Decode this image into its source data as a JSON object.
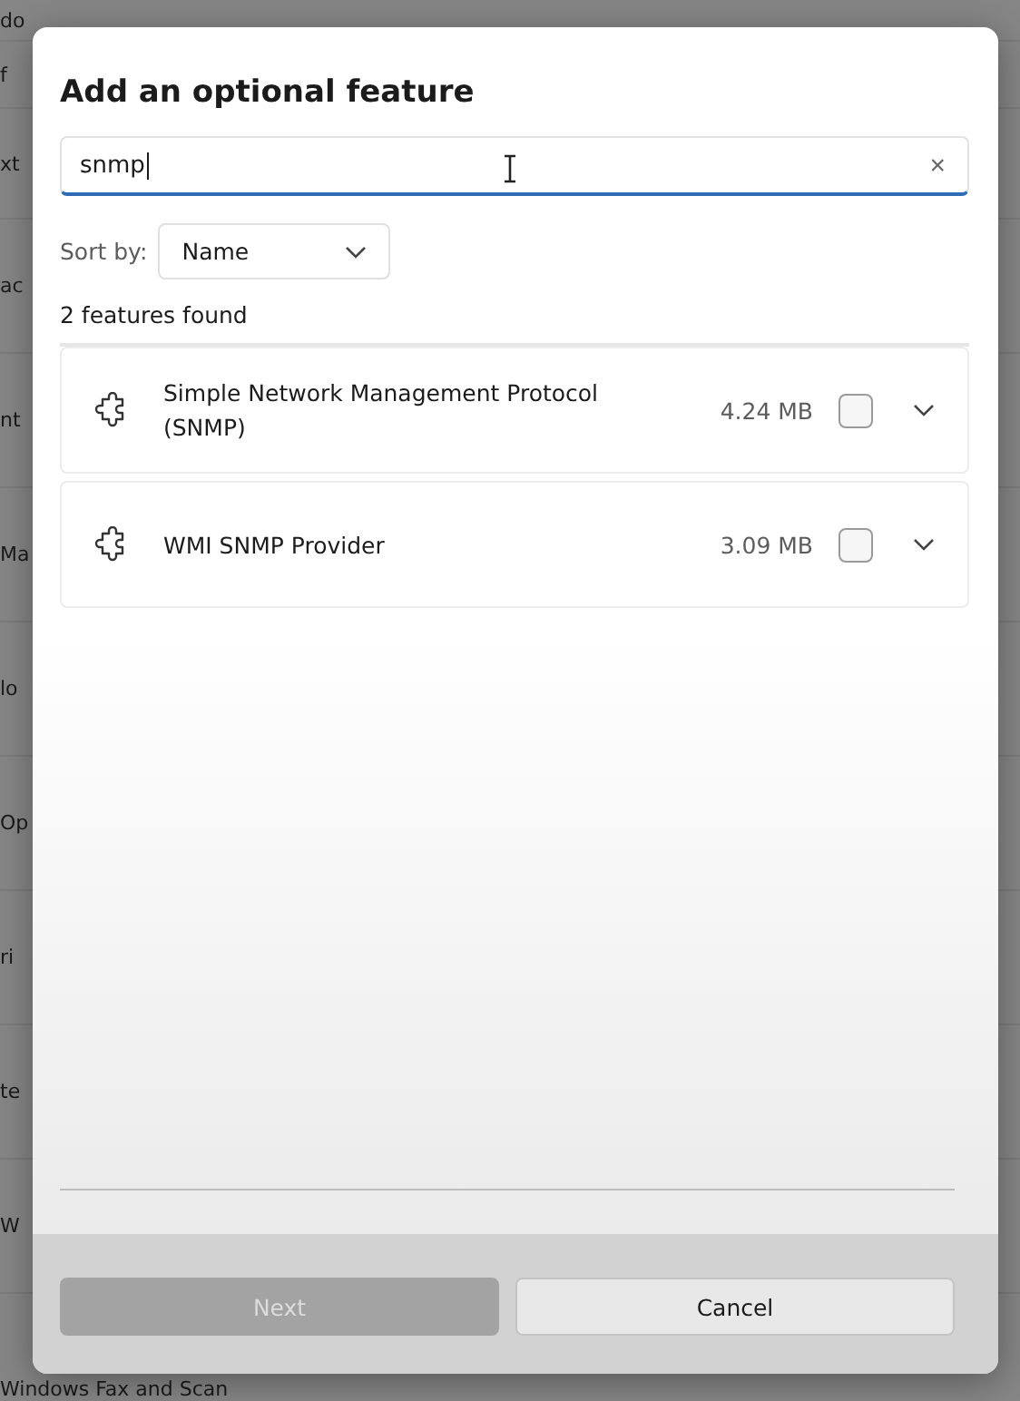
{
  "background_items": [
    "do",
    "f",
    "xt",
    "ac",
    "nt",
    "Ma",
    "lo",
    "Op",
    "ri",
    "te",
    "W",
    "Windows Fax and Scan"
  ],
  "dialog": {
    "title": "Add an optional feature",
    "search": {
      "value": "snmp",
      "clear": "×"
    },
    "sort": {
      "label": "Sort by:",
      "value": "Name"
    },
    "result_count": "2 features found",
    "features": [
      {
        "name": "Simple Network Management Protocol (SNMP)",
        "size": "4.24 MB",
        "checked": false,
        "expanded": false
      },
      {
        "name": "WMI SNMP Provider",
        "size": "3.09 MB",
        "checked": false,
        "expanded": false
      }
    ],
    "buttons": [
      {
        "label": "Next",
        "kind": "primary",
        "disabled": true
      },
      {
        "label": "Cancel",
        "kind": "secondary",
        "disabled": false
      }
    ]
  }
}
